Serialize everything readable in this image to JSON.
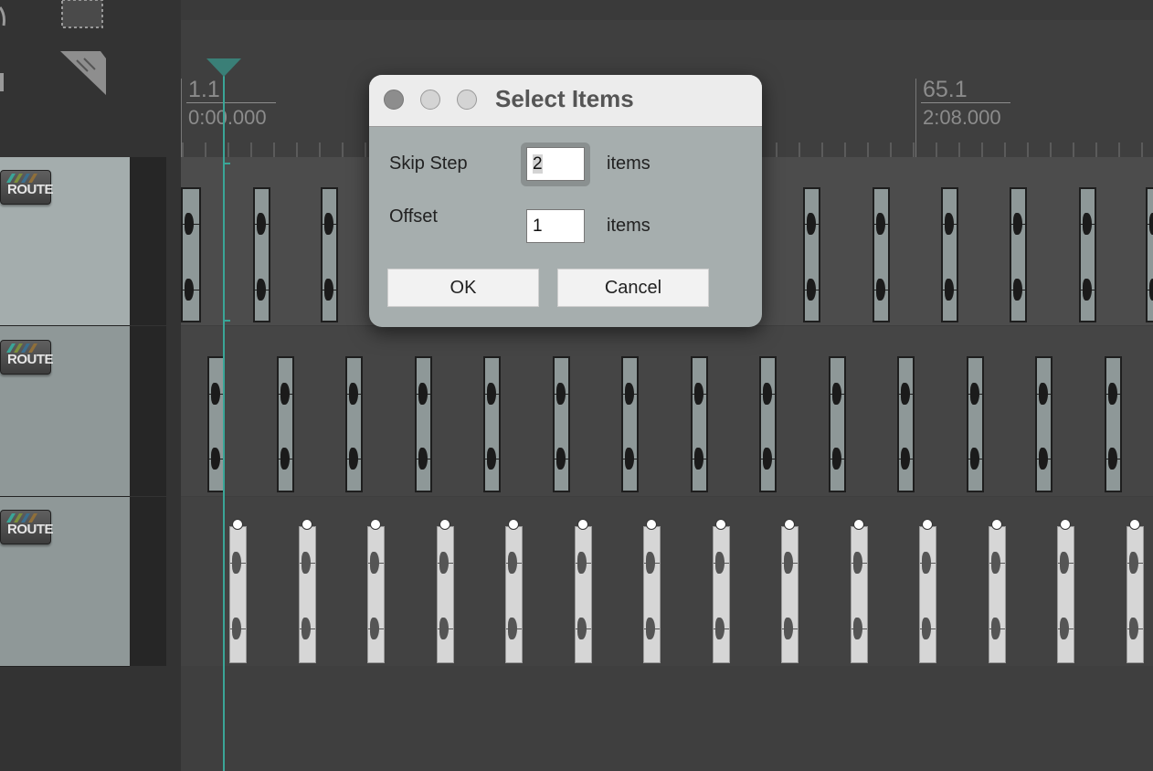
{
  "timeline": {
    "marker_start": "1.1",
    "marker_start_time": "0:00.000",
    "marker_mid": "65.1",
    "marker_mid_time": "2:08.000"
  },
  "tracks": [
    {
      "route_label": "ROUTE"
    },
    {
      "route_label": "ROUTE"
    },
    {
      "route_label": "ROUTE"
    }
  ],
  "dialog": {
    "title": "Select Items",
    "skip_step_label": "Skip Step",
    "skip_step_value": "2",
    "skip_step_unit": "items",
    "offset_label": "Offset",
    "offset_value": "1",
    "offset_unit": "items",
    "ok_label": "OK",
    "cancel_label": "Cancel"
  },
  "colors": {
    "playhead": "#3aa597",
    "track_header": "#a4adad",
    "dialog_bg": "#a6aeae"
  }
}
